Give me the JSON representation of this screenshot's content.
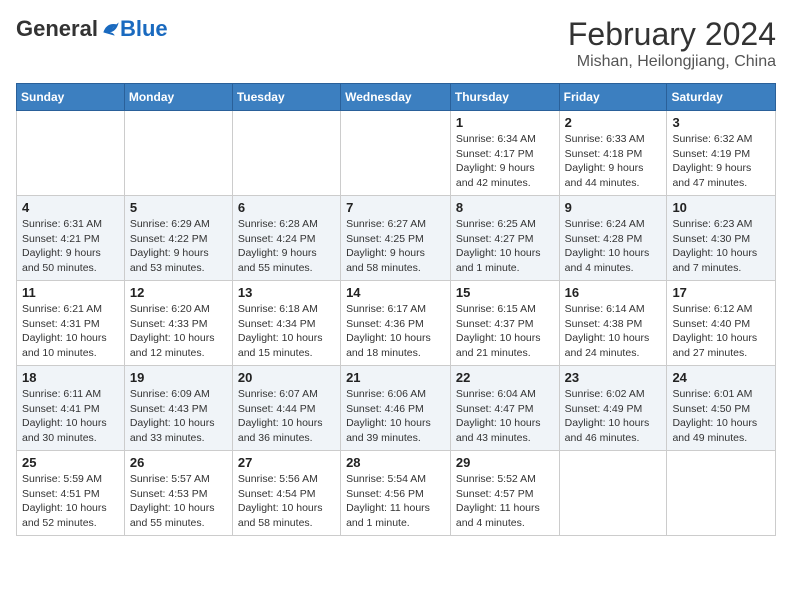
{
  "logo": {
    "general": "General",
    "blue": "Blue"
  },
  "header": {
    "month": "February 2024",
    "location": "Mishan, Heilongjiang, China"
  },
  "days_of_week": [
    "Sunday",
    "Monday",
    "Tuesday",
    "Wednesday",
    "Thursday",
    "Friday",
    "Saturday"
  ],
  "weeks": [
    [
      {
        "day": "",
        "info": ""
      },
      {
        "day": "",
        "info": ""
      },
      {
        "day": "",
        "info": ""
      },
      {
        "day": "",
        "info": ""
      },
      {
        "day": "1",
        "info": "Sunrise: 6:34 AM\nSunset: 4:17 PM\nDaylight: 9 hours and 42 minutes."
      },
      {
        "day": "2",
        "info": "Sunrise: 6:33 AM\nSunset: 4:18 PM\nDaylight: 9 hours and 44 minutes."
      },
      {
        "day": "3",
        "info": "Sunrise: 6:32 AM\nSunset: 4:19 PM\nDaylight: 9 hours and 47 minutes."
      }
    ],
    [
      {
        "day": "4",
        "info": "Sunrise: 6:31 AM\nSunset: 4:21 PM\nDaylight: 9 hours and 50 minutes."
      },
      {
        "day": "5",
        "info": "Sunrise: 6:29 AM\nSunset: 4:22 PM\nDaylight: 9 hours and 53 minutes."
      },
      {
        "day": "6",
        "info": "Sunrise: 6:28 AM\nSunset: 4:24 PM\nDaylight: 9 hours and 55 minutes."
      },
      {
        "day": "7",
        "info": "Sunrise: 6:27 AM\nSunset: 4:25 PM\nDaylight: 9 hours and 58 minutes."
      },
      {
        "day": "8",
        "info": "Sunrise: 6:25 AM\nSunset: 4:27 PM\nDaylight: 10 hours and 1 minute."
      },
      {
        "day": "9",
        "info": "Sunrise: 6:24 AM\nSunset: 4:28 PM\nDaylight: 10 hours and 4 minutes."
      },
      {
        "day": "10",
        "info": "Sunrise: 6:23 AM\nSunset: 4:30 PM\nDaylight: 10 hours and 7 minutes."
      }
    ],
    [
      {
        "day": "11",
        "info": "Sunrise: 6:21 AM\nSunset: 4:31 PM\nDaylight: 10 hours and 10 minutes."
      },
      {
        "day": "12",
        "info": "Sunrise: 6:20 AM\nSunset: 4:33 PM\nDaylight: 10 hours and 12 minutes."
      },
      {
        "day": "13",
        "info": "Sunrise: 6:18 AM\nSunset: 4:34 PM\nDaylight: 10 hours and 15 minutes."
      },
      {
        "day": "14",
        "info": "Sunrise: 6:17 AM\nSunset: 4:36 PM\nDaylight: 10 hours and 18 minutes."
      },
      {
        "day": "15",
        "info": "Sunrise: 6:15 AM\nSunset: 4:37 PM\nDaylight: 10 hours and 21 minutes."
      },
      {
        "day": "16",
        "info": "Sunrise: 6:14 AM\nSunset: 4:38 PM\nDaylight: 10 hours and 24 minutes."
      },
      {
        "day": "17",
        "info": "Sunrise: 6:12 AM\nSunset: 4:40 PM\nDaylight: 10 hours and 27 minutes."
      }
    ],
    [
      {
        "day": "18",
        "info": "Sunrise: 6:11 AM\nSunset: 4:41 PM\nDaylight: 10 hours and 30 minutes."
      },
      {
        "day": "19",
        "info": "Sunrise: 6:09 AM\nSunset: 4:43 PM\nDaylight: 10 hours and 33 minutes."
      },
      {
        "day": "20",
        "info": "Sunrise: 6:07 AM\nSunset: 4:44 PM\nDaylight: 10 hours and 36 minutes."
      },
      {
        "day": "21",
        "info": "Sunrise: 6:06 AM\nSunset: 4:46 PM\nDaylight: 10 hours and 39 minutes."
      },
      {
        "day": "22",
        "info": "Sunrise: 6:04 AM\nSunset: 4:47 PM\nDaylight: 10 hours and 43 minutes."
      },
      {
        "day": "23",
        "info": "Sunrise: 6:02 AM\nSunset: 4:49 PM\nDaylight: 10 hours and 46 minutes."
      },
      {
        "day": "24",
        "info": "Sunrise: 6:01 AM\nSunset: 4:50 PM\nDaylight: 10 hours and 49 minutes."
      }
    ],
    [
      {
        "day": "25",
        "info": "Sunrise: 5:59 AM\nSunset: 4:51 PM\nDaylight: 10 hours and 52 minutes."
      },
      {
        "day": "26",
        "info": "Sunrise: 5:57 AM\nSunset: 4:53 PM\nDaylight: 10 hours and 55 minutes."
      },
      {
        "day": "27",
        "info": "Sunrise: 5:56 AM\nSunset: 4:54 PM\nDaylight: 10 hours and 58 minutes."
      },
      {
        "day": "28",
        "info": "Sunrise: 5:54 AM\nSunset: 4:56 PM\nDaylight: 11 hours and 1 minute."
      },
      {
        "day": "29",
        "info": "Sunrise: 5:52 AM\nSunset: 4:57 PM\nDaylight: 11 hours and 4 minutes."
      },
      {
        "day": "",
        "info": ""
      },
      {
        "day": "",
        "info": ""
      }
    ]
  ]
}
